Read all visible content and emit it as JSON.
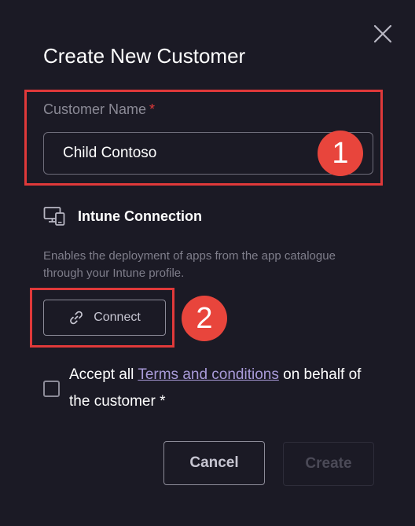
{
  "dialog": {
    "title": "Create New Customer",
    "close_icon": "close-icon"
  },
  "customer_name": {
    "label": "Customer Name",
    "required_marker": "*",
    "value": "Child Contoso"
  },
  "intune": {
    "icon": "monitor-devices-icon",
    "title": "Intune Connection",
    "description": "Enables the deployment of apps from the app catalogue through your Intune profile.",
    "connect_label": "Connect",
    "connect_icon": "link-icon"
  },
  "terms": {
    "checked": false,
    "prefix": "Accept all ",
    "link_text": "Terms and conditions",
    "suffix": " on behalf of the customer *"
  },
  "footer": {
    "cancel_label": "Cancel",
    "create_label": "Create"
  },
  "annotations": {
    "callout_1": "1",
    "callout_2": "2",
    "color": "#e0393a"
  },
  "colors": {
    "background": "#1b1a25",
    "accent_link": "#a99bd9",
    "required": "#e0393a"
  }
}
